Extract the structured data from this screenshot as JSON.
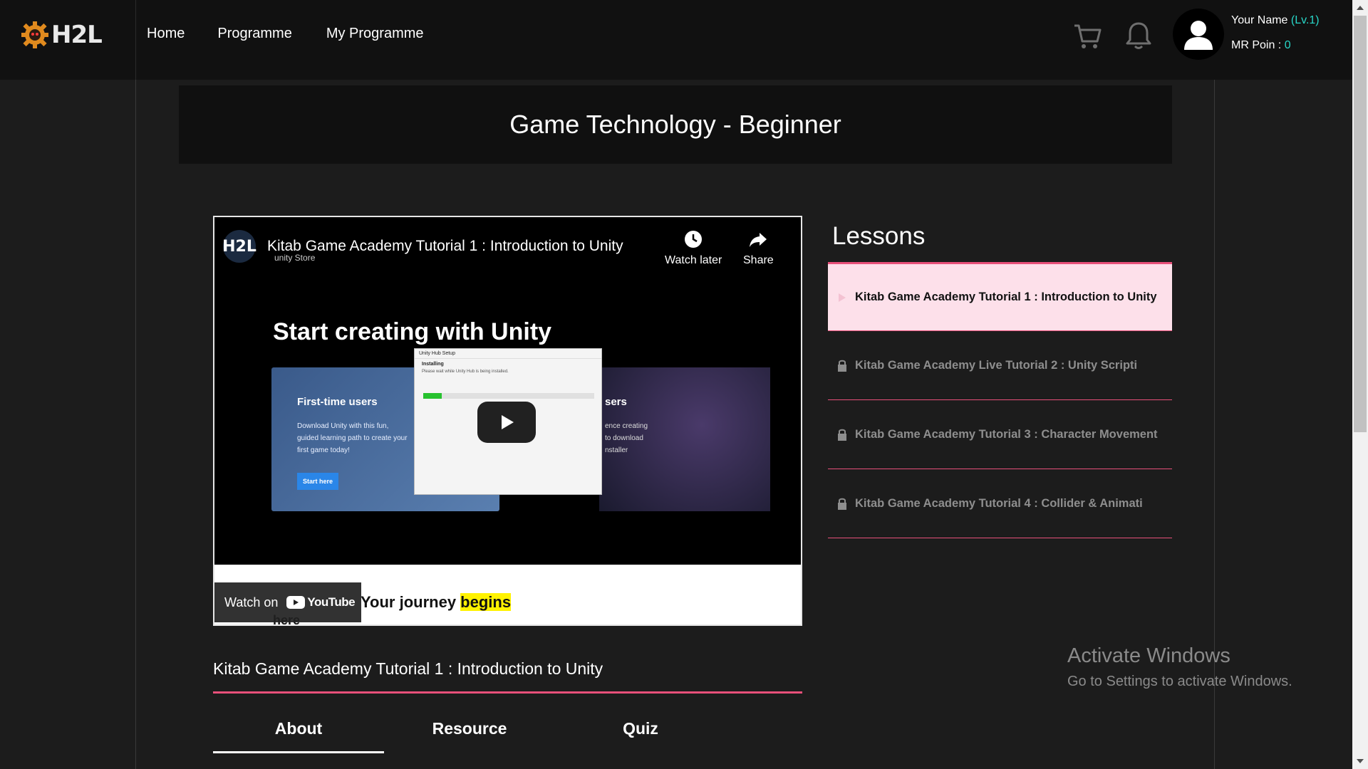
{
  "brand": {
    "logo_text": "H2L"
  },
  "nav": {
    "items": [
      "Home",
      "Programme",
      "My Programme"
    ]
  },
  "header_icons": {
    "cart": "cart-icon",
    "bell": "bell-icon",
    "avatar": "user-avatar-icon"
  },
  "user": {
    "name": "Your Name",
    "level": "(Lv.1)",
    "points_label": "MR Poin : ",
    "points_value": "0"
  },
  "page": {
    "title": "Game Technology - Beginner"
  },
  "video": {
    "channel_logo": "H2L",
    "title": "Kitab Game Academy Tutorial 1 : Introduction to Unity",
    "store_label": "unity Store",
    "watch_later": "Watch later",
    "share": "Share",
    "headline": "Start creating with Unity",
    "card_first_title": "First-time users",
    "card_first_desc": "Download Unity with this fun, guided learning path to create your first game today!",
    "card_first_button": "Start here",
    "card_second_title": "sers",
    "card_second_desc": "ence creating\nto download\nnstaller",
    "dialog_title": "Unity Hub Setup",
    "dialog_heading": "Installing",
    "dialog_sub": "Please wait while Unity Hub is being installed.",
    "install_progress": 0.11,
    "journey_text": "Your journey ",
    "journey_highlight": "begins",
    "here_text": "here",
    "watch_on": "Watch on",
    "youtube": "YouTube"
  },
  "lesson": {
    "current_title": "Kitab Game Academy Tutorial 1 : Introduction to Unity",
    "tabs": [
      "About",
      "Resource",
      "Quiz"
    ]
  },
  "lessons": {
    "heading": "Lessons",
    "items": [
      {
        "label": "Kitab Game Academy Tutorial 1 : Introduction to Unity",
        "icon": "play-icon",
        "active": true
      },
      {
        "label": "Kitab Game Academy Live Tutorial 2 : Unity Scripti",
        "icon": "lock-icon",
        "active": false
      },
      {
        "label": "Kitab Game Academy Tutorial 3 : Character Movement",
        "icon": "lock-icon",
        "active": false
      },
      {
        "label": "Kitab Game Academy Tutorial 4 : Collider & Animati",
        "icon": "lock-icon",
        "active": false
      }
    ]
  },
  "watermark": {
    "line1": "Activate Windows",
    "line2": "Go to Settings to activate Windows."
  },
  "colors": {
    "accent": "#e8507a",
    "teal": "#28d7c8",
    "active_bg": "#fde0ea"
  }
}
